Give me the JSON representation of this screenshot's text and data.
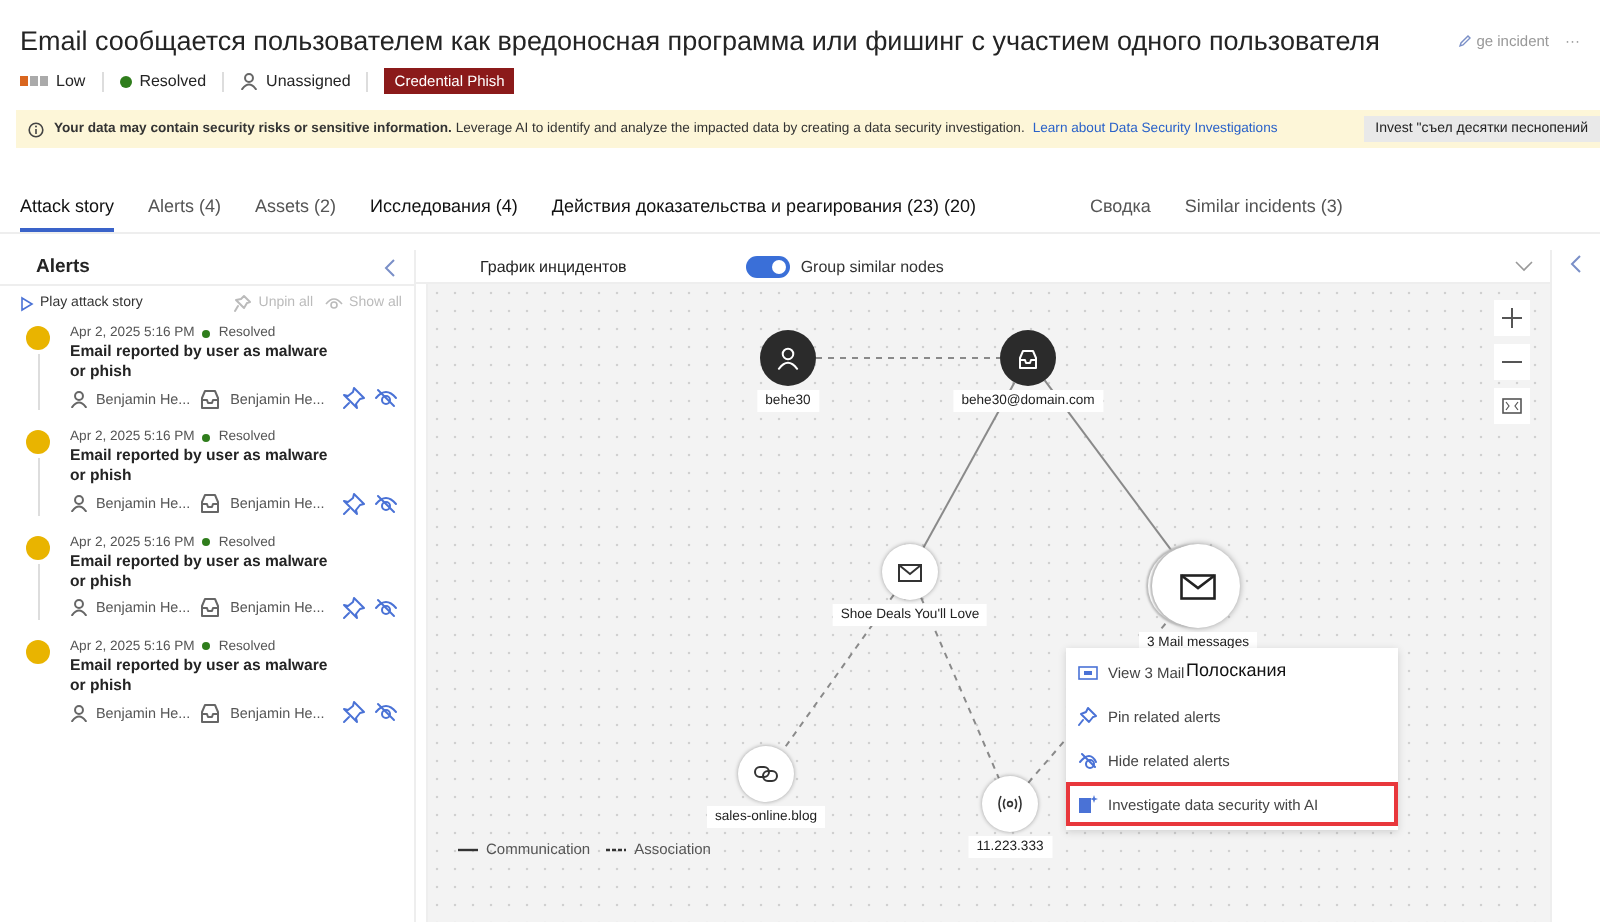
{
  "incident": {
    "title": "Email сообщается пользователем как вредоносная программа или фишинг с участием одного пользователя",
    "severity": "Low",
    "status": "Resolved",
    "assignee": "Unassigned",
    "tags": [
      "Credential Phish"
    ],
    "actions": [
      {
        "kind": "manage",
        "label": "ge incident"
      },
      {
        "kind": "more",
        "label": "···"
      }
    ]
  },
  "banner": {
    "message": "**Your data may contain security risks or sensitive information.** Leverage AI to identify and analyze the impacted data by creating a data security investigation.",
    "link": "Learn about Data Security Investigations",
    "button": "Invest \"съел десятки песнопений"
  },
  "tabs": [
    {
      "label": "Attack story",
      "selected": true
    },
    {
      "label": "Alerts (4)",
      "selected": false
    },
    {
      "label": "Assets (2)",
      "selected": false
    },
    {
      "label": "Исследования (4)",
      "selected": false
    },
    {
      "label": "Действия доказательства и реагирования (23) (20)",
      "selected": false
    },
    {
      "label": "Сводка",
      "selected": false
    },
    {
      "label": "Similar incidents (3)",
      "selected": false
    }
  ],
  "alerts_panel": {
    "title": "Alerts",
    "play": "Play attack story",
    "unpin_all": {
      "label": "Unpin all",
      "disabled": true
    },
    "show_all": {
      "label": "Show all",
      "disabled": true
    },
    "alerts": [
      {
        "date": "Apr 2, 2025 5:16 PM",
        "status": "Resolved",
        "title": "Email reported by user as malware or phish",
        "user": "Benjamin He...",
        "mailbox": "Benjamin He..."
      },
      {
        "date": "Apr 2, 2025 5:16 PM",
        "status": "Resolved",
        "title": "Email reported by user as malware or phish",
        "user": "Benjamin He...",
        "mailbox": "Benjamin He..."
      },
      {
        "date": "Apr 2, 2025 5:16 PM",
        "status": "Resolved",
        "title": "Email reported by user as malware or phish",
        "user": "Benjamin He...",
        "mailbox": "Benjamin He..."
      },
      {
        "date": "Apr 2, 2025 5:16 PM",
        "status": "Resolved",
        "title": "Email reported by user as malware or phish",
        "user": "Benjamin He...",
        "mailbox": "Benjamin He..."
      }
    ]
  },
  "graph": {
    "title": "График инцидентов",
    "toggle": {
      "label": "Group similar nodes",
      "on": true
    },
    "nodes": [
      {
        "kind": "user",
        "label": "behe30"
      },
      {
        "kind": "mailbox",
        "label": "behe30@domain.com"
      },
      {
        "kind": "email",
        "label": "Shoe Deals You'll Love"
      },
      {
        "kind": "email-group",
        "label": "3 Mail messages"
      },
      {
        "kind": "url",
        "label": "sales-online.blog"
      },
      {
        "kind": "ip",
        "label": "11.223.333"
      }
    ],
    "menu": [
      {
        "kind": "view",
        "label": "View 3 Mail",
        "overlay": "Полоскания",
        "highlighted": false
      },
      {
        "kind": "pin",
        "label": "Pin related alerts",
        "highlighted": false
      },
      {
        "kind": "hide",
        "label": "Hide related alerts",
        "highlighted": false
      },
      {
        "kind": "investigate",
        "label": "Investigate data security with AI",
        "highlighted": true
      }
    ],
    "legend": [
      {
        "kind": "communication",
        "label": "Communication"
      },
      {
        "kind": "association",
        "label": "Association"
      }
    ]
  }
}
